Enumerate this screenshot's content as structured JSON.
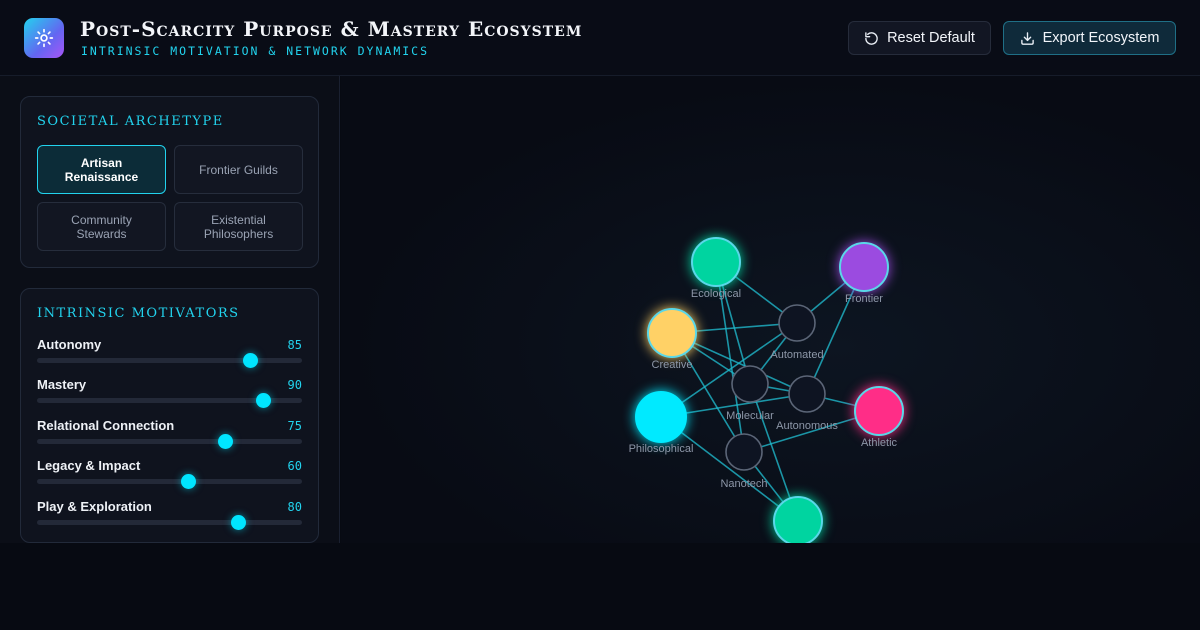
{
  "header": {
    "title": "Post-Scarcity Purpose & Mastery Ecosystem",
    "subtitle": "INTRINSIC MOTIVATION & NETWORK DYNAMICS",
    "logo_icon": "sun-gear-icon",
    "reset_label": "Reset Default",
    "reset_icon": "rotate-ccw-icon",
    "export_label": "Export Ecosystem",
    "export_icon": "download-icon"
  },
  "archetype": {
    "title": "SOCIETAL ARCHETYPE",
    "options": [
      {
        "label": "Artisan Renaissance",
        "active": true
      },
      {
        "label": "Frontier Guilds",
        "active": false
      },
      {
        "label": "Community Stewards",
        "active": false
      },
      {
        "label": "Existential Philosophers",
        "active": false
      }
    ]
  },
  "motivators": {
    "title": "INTRINSIC MOTIVATORS",
    "items": [
      {
        "label": "Autonomy",
        "value": 85
      },
      {
        "label": "Mastery",
        "value": 90
      },
      {
        "label": "Relational Connection",
        "value": 75
      },
      {
        "label": "Legacy & Impact",
        "value": 60
      },
      {
        "label": "Play & Exploration",
        "value": 80
      }
    ],
    "min": 0,
    "max": 100
  },
  "graph": {
    "nodes": [
      {
        "id": "ecological",
        "label": "Ecological",
        "color": "#00d4a0",
        "kind": "purpose"
      },
      {
        "id": "frontier",
        "label": "Frontier",
        "color": "#9b4be0",
        "kind": "purpose"
      },
      {
        "id": "creative",
        "label": "Creative",
        "color": "#ffd166",
        "kind": "purpose"
      },
      {
        "id": "automated",
        "label": "Automated",
        "color": "#0e1422",
        "kind": "infra"
      },
      {
        "id": "molecular",
        "label": "Molecular",
        "color": "#0e1422",
        "kind": "infra"
      },
      {
        "id": "autonomous",
        "label": "Autonomous",
        "color": "#0e1422",
        "kind": "infra"
      },
      {
        "id": "athletic",
        "label": "Athletic",
        "color": "#ff2d87",
        "kind": "purpose"
      },
      {
        "id": "philosophical",
        "label": "Philosophical",
        "color": "#00eaff",
        "kind": "purpose"
      },
      {
        "id": "nanotech",
        "label": "Nanotech",
        "color": "#0e1422",
        "kind": "infra"
      },
      {
        "id": "bottom",
        "label": "",
        "color": "#00d4a0",
        "kind": "purpose"
      }
    ],
    "edges": [
      [
        "ecological",
        "automated"
      ],
      [
        "ecological",
        "molecular"
      ],
      [
        "ecological",
        "nanotech"
      ],
      [
        "frontier",
        "automated"
      ],
      [
        "frontier",
        "autonomous"
      ],
      [
        "creative",
        "molecular"
      ],
      [
        "creative",
        "autonomous"
      ],
      [
        "creative",
        "nanotech"
      ],
      [
        "creative",
        "automated"
      ],
      [
        "automated",
        "philosophical"
      ],
      [
        "automated",
        "molecular"
      ],
      [
        "molecular",
        "autonomous"
      ],
      [
        "molecular",
        "bottom"
      ],
      [
        "autonomous",
        "athletic"
      ],
      [
        "philosophical",
        "autonomous"
      ],
      [
        "philosophical",
        "bottom"
      ],
      [
        "nanotech",
        "athletic"
      ],
      [
        "nanotech",
        "bottom"
      ]
    ],
    "edge_color": "#1fb6c9"
  }
}
